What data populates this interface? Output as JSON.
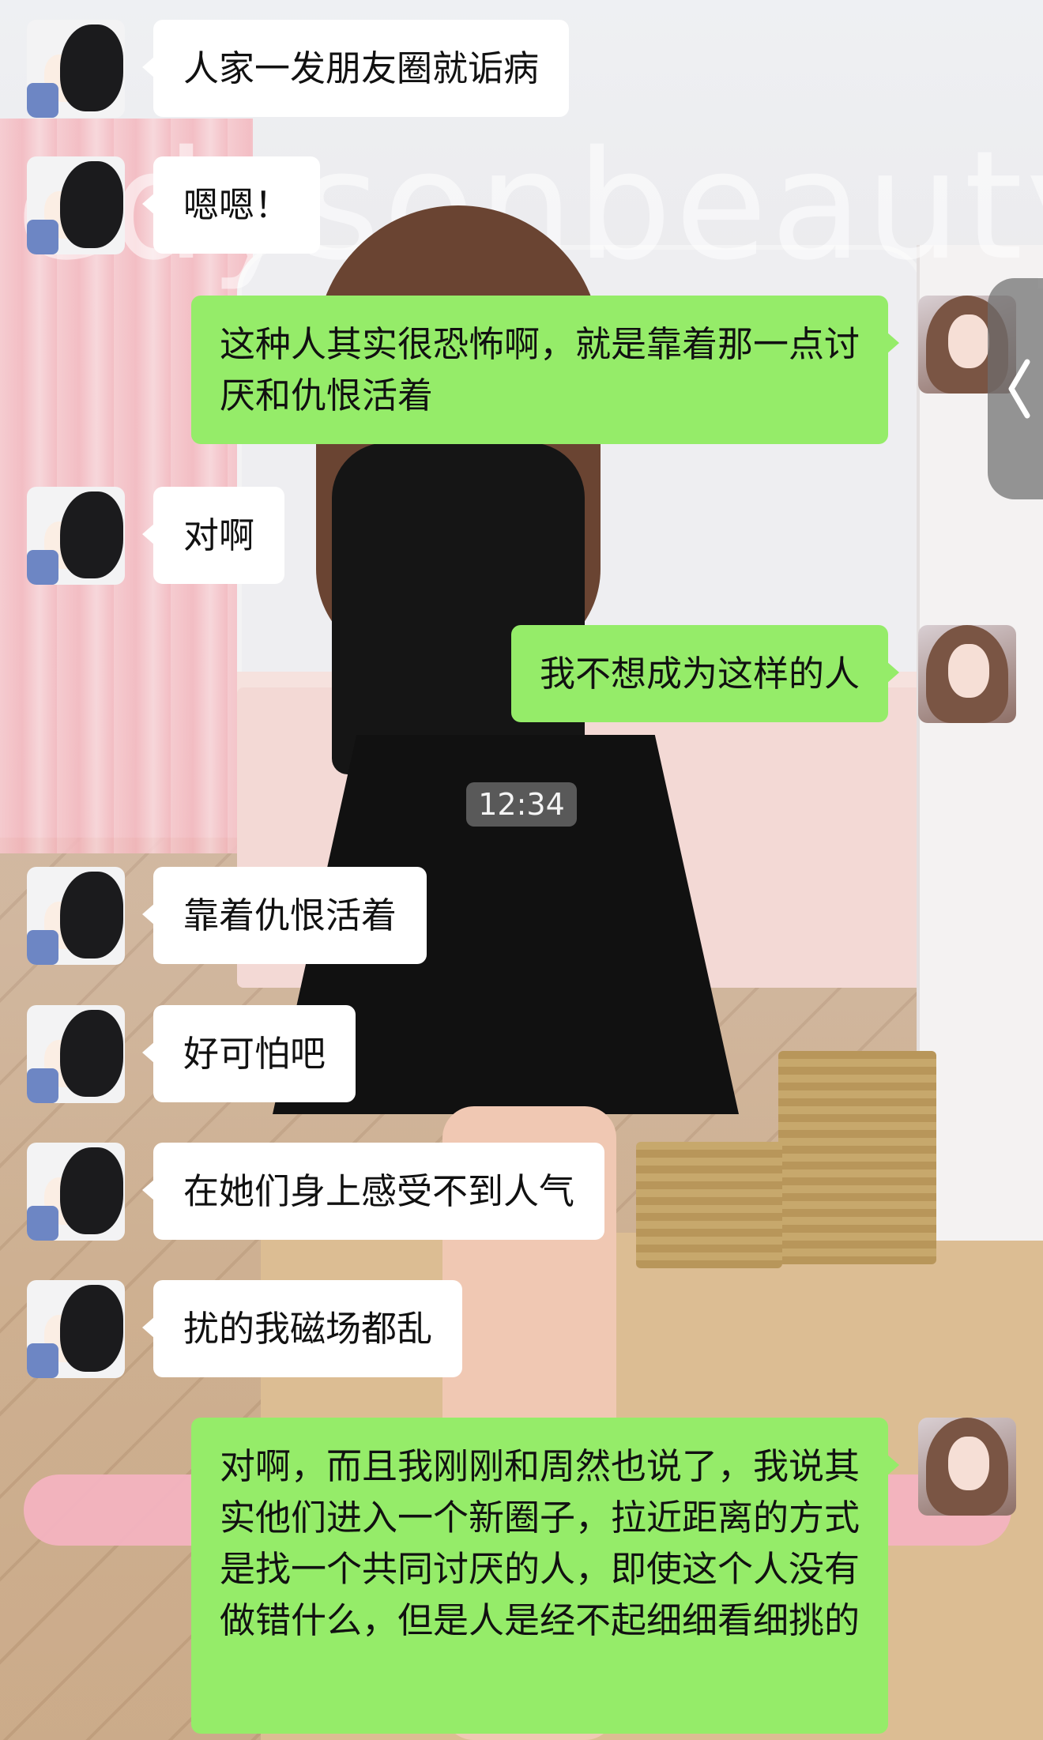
{
  "timestamp": "12:34",
  "background": {
    "watermark": "edysonbeauty"
  },
  "colors": {
    "incoming_bubble": "#ffffff",
    "outgoing_bubble": "#95ec69",
    "timestamp_bg": "#9a9a9a"
  },
  "messages": [
    {
      "side": "in",
      "text": "人家一发朋友圈就诟病"
    },
    {
      "side": "in",
      "text": "嗯嗯！"
    },
    {
      "side": "out",
      "text": "这种人其实很恐怖啊，就是靠着那一点讨厌和仇恨活着"
    },
    {
      "side": "in",
      "text": "对啊"
    },
    {
      "side": "out",
      "text": "我不想成为这样的人"
    },
    {
      "side": "in",
      "text": "靠着仇恨活着"
    },
    {
      "side": "in",
      "text": "好可怕吧"
    },
    {
      "side": "in",
      "text": "在她们身上感受不到人气"
    },
    {
      "side": "in",
      "text": "扰的我磁场都乱"
    },
    {
      "side": "out",
      "text": "对啊，而且我刚刚和周然也说了，我说其实他们进入一个新圈子，拉近距离的方式是找一个共同讨厌的人，即使这个人没有做错什么，但是人是经不起细细看细挑的"
    }
  ],
  "icons": {
    "friend_avatar": "anime-boy-avatar",
    "self_avatar": "girl-photo-avatar",
    "side_handle": "chevron-left-icon"
  }
}
